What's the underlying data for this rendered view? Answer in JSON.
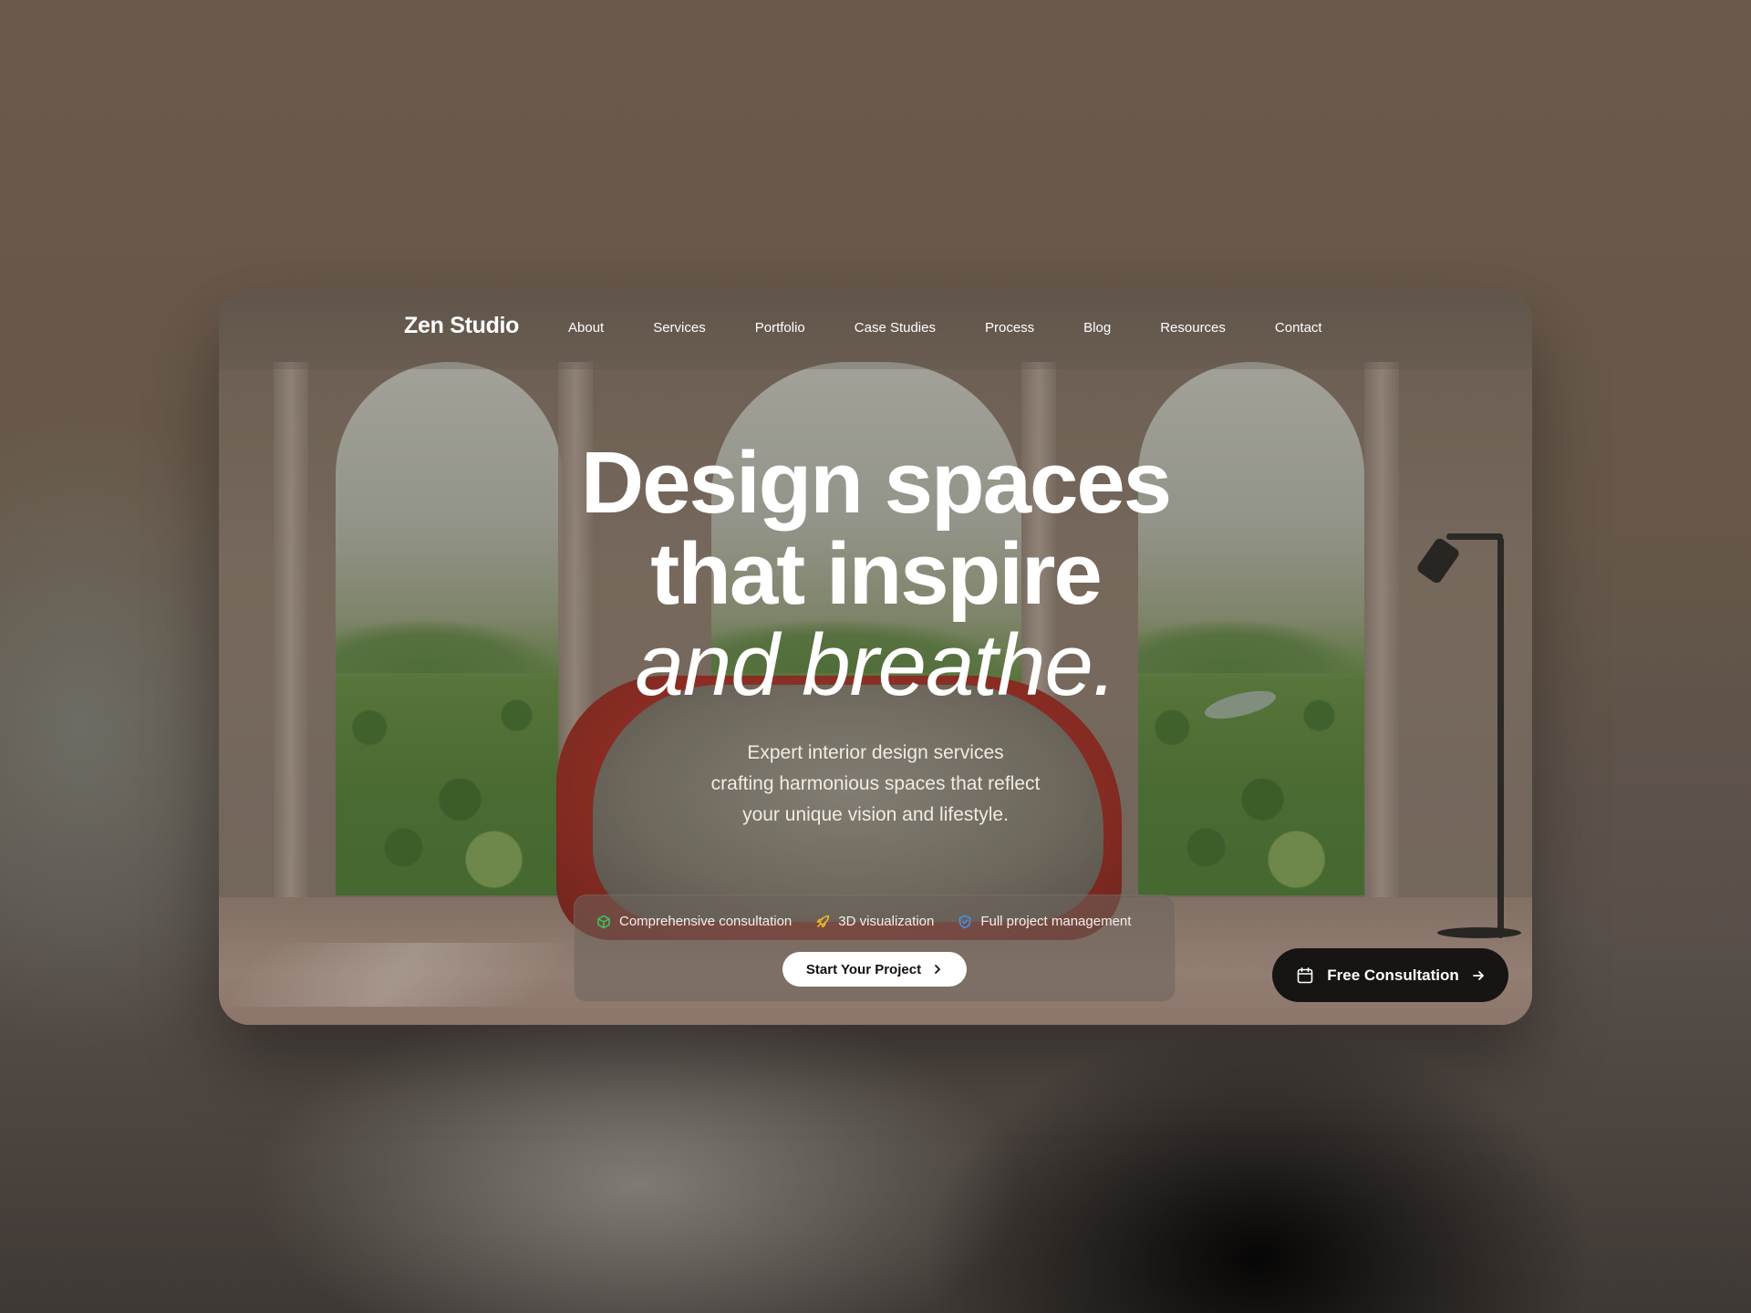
{
  "brand": "Zen Studio",
  "nav": [
    {
      "label": "About"
    },
    {
      "label": "Services"
    },
    {
      "label": "Portfolio"
    },
    {
      "label": "Case Studies"
    },
    {
      "label": "Process"
    },
    {
      "label": "Blog"
    },
    {
      "label": "Resources"
    },
    {
      "label": "Contact"
    }
  ],
  "hero": {
    "line1": "Design spaces",
    "line2": "that inspire",
    "line3": "and breathe.",
    "sub1": "Expert interior design services",
    "sub2": "crafting harmonious spaces that reflect",
    "sub3": "your unique vision and lifestyle."
  },
  "features": [
    {
      "label": "Comprehensive consultation",
      "icon": "cube-icon",
      "color": "#3fbf5f"
    },
    {
      "label": "3D visualization",
      "icon": "rocket-icon",
      "color": "#f0b429"
    },
    {
      "label": "Full project management",
      "icon": "shield-icon",
      "color": "#4a8fe8"
    }
  ],
  "cta": {
    "label": "Start Your Project",
    "icon": "chevron-right-icon"
  },
  "consult": {
    "label": "Free Consultation",
    "icon": "calendar-icon",
    "trailing_icon": "arrow-right-icon"
  }
}
